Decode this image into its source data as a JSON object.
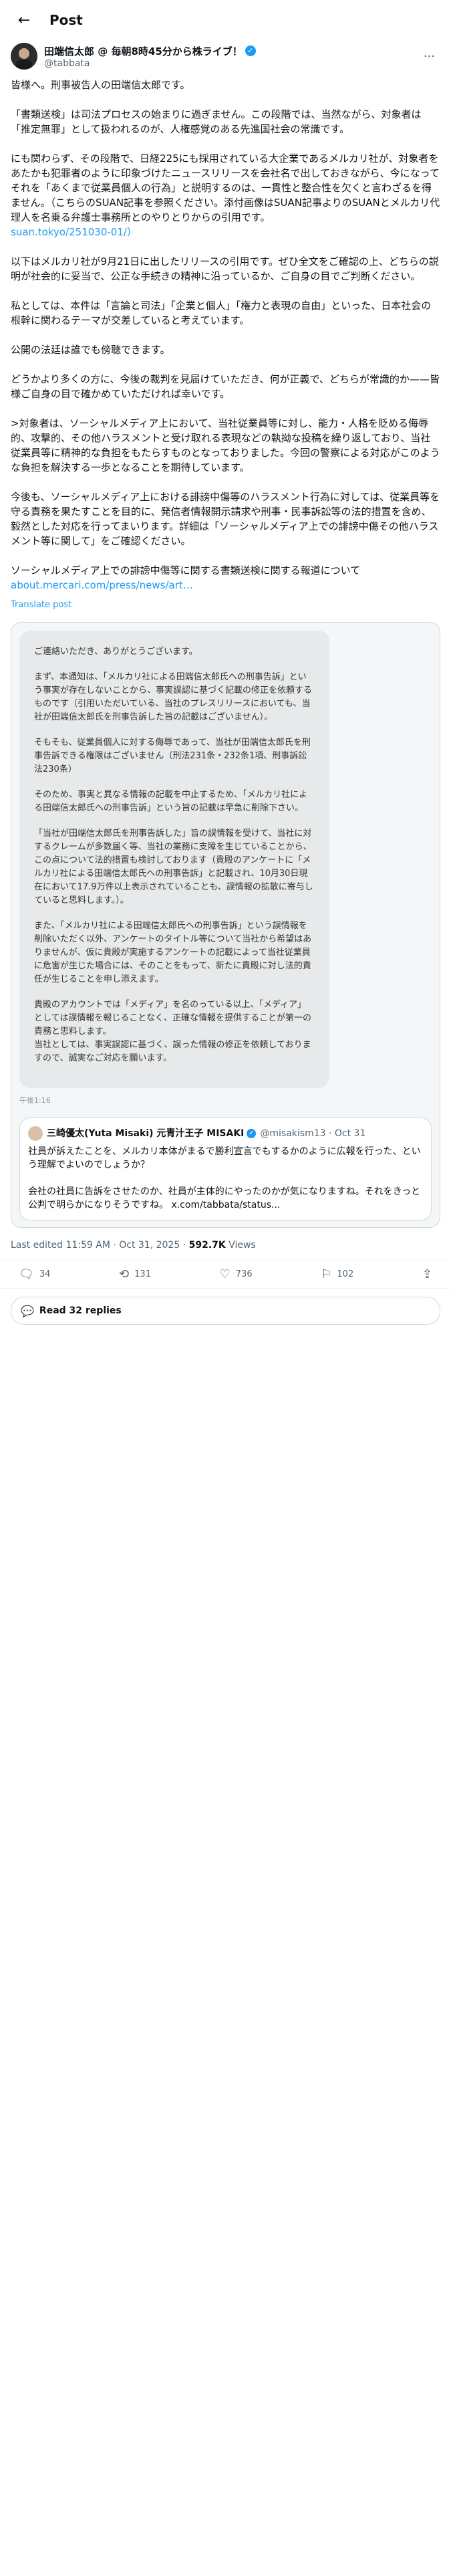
{
  "header": {
    "title": "Post"
  },
  "author": {
    "name": "田端信太郎 @ 毎朝8時45分から株ライブ！",
    "handle": "@tabbata"
  },
  "post": {
    "paragraphs": [
      "皆様へ。刑事被告人の田端信太郎です。",
      "「書類送検」は司法プロセスの始まりに過ぎません。この段階では、当然ながら、対象者は「推定無罪」として扱われるのが、人権感覚のある先進国社会の常識です。",
      "にも関わらず、その段階で、日経225にも採用されている大企業であるメルカリ社が、対象者をあたかも犯罪者のように印象づけたニュースリリースを会社名で出しておきながら、今になってそれを「あくまで従業員個人の行為」と説明するのは、一貫性と整合性を欠くと言わざるを得ません。（こちらのSUAN記事を参照ください。添付画像はSUAN記事よりのSUANとメルカリ代理人を名乗る弁護士事務所とのやりとりからの引用です。",
      "以下はメルカリ社が9月21日に出したリリースの引用です。ぜひ全文をご確認の上、どちらの説明が社会的に妥当で、公正な手続きの精神に沿っているか、ご自身の目でご判断ください。",
      "私としては、本件は「言論と司法」「企業と個人」「権力と表現の自由」といった、日本社会の根幹に関わるテーマが交差していると考えています。",
      "公開の法廷は誰でも傍聴できます。",
      "どうかより多くの方に、今後の裁判を見届けていただき、何が正義で、どちらが常識的か——皆様ご自身の目で確かめていただければ幸いです。",
      ">対象者は、ソーシャルメディア上において、当社従業員等に対し、能力・人格を貶める侮辱的、攻撃的、その他ハラスメントと受け取れる表現などの執拗な投稿を繰り返しており、当社従業員等に精神的な負担をもたらすものとなっておりました。今回の警察による対応がこのような負担を解決する一歩となることを期待しています。",
      "今後も、ソーシャルメディア上における誹謗中傷等のハラスメント行為に対しては、従業員等を守る責務を果たすことを目的に、発信者情報開示請求や刑事・民事訴訟等の法的措置を含め、毅然とした対応を行ってまいります。詳細は「ソーシャルメディア上での誹謗中傷その他ハラスメント等に関して」をご確認ください。",
      "ソーシャルメディア上での誹謗中傷等に関する書類送検に関する報道について"
    ],
    "link1": "suan.tokyo/251030-01/）",
    "link2": "about.mercari.com/press/news/art…",
    "translate": "Translate post"
  },
  "image": {
    "paragraphs": [
      "ご連絡いただき、ありがとうございます。",
      "まず、本通知は、「メルカリ社による田端信太郎氏への刑事告訴」という事実が存在しないことから、事実誤認に基づく記載の修正を依頼するものです（引用いただいている、当社のプレスリリースにおいても、当社が田端信太郎氏を刑事告訴した旨の記載はございません）。",
      "そもそも、従業員個人に対する侮辱であって、当社が田端信太郎氏を刑事告訴できる権限はございません（刑法231条・232条1項、刑事訴訟法230条）",
      "そのため、事実と異なる情報の記載を中止するため、「メルカリ社による田端信太郎氏への刑事告訴」という旨の記載は早急に削除下さい。",
      "「当社が田端信太郎氏を刑事告訴した」旨の誤情報を受けて、当社に対するクレームが多数届く等、当社の業務に支障を生じていることから、この点について法的措置も検討しております（貴殿のアンケートに「メルカリ社による田端信太郎氏への刑事告訴」と記載され、10月30日現在において17.9万件以上表示されていることも、誤情報の拡散に寄与していると思料します。）。",
      "また、「メルカリ社による田端信太郎氏への刑事告訴」という誤情報を削除いただく以外、アンケートのタイトル等について当社から希望はありませんが、仮に貴殿が実施するアンケートの記載によって当社従業員に危害が生じた場合には、そのことをもって、新たに貴殿に対し法的責任が生じることを申し添えます。",
      "貴殿のアカウントでは「メディア」を名のっている以上、「メディア」としては誤情報を報じることなく、正確な情報を提供することが第一の責務と思料します。\n当社としては、事実誤認に基づく、誤った情報の修正を依頼しておりますので、誠実なご対応を願います。"
    ],
    "time": "午後1:16"
  },
  "quote": {
    "name": "三崎優太(Yuta Misaki) 元青汁王子 MISAKI",
    "handle": "@misakism13 · Oct 31",
    "text": "社員が訴えたことを、メルカリ本体がまるで勝利宣言でもするかのように広報を行った、という理解でよいのでしょうか？\n\n会社の社員に告訴をさせたのか、社員が主体的にやったのかが気になりますね。それをきっと公判で明らかになりそうですね。 x.com/tabbata/status..."
  },
  "meta": {
    "time": "Last edited 11:59 AM · Oct 31, 2025 · ",
    "views_count": "592.7K",
    "views_label": " Views"
  },
  "actions": {
    "replies": "34",
    "reposts": "131",
    "likes": "736",
    "bookmarks": "102"
  },
  "read_replies": "Read 32 replies",
  "colors": {
    "link": "#1d9bf0",
    "text": "#0f1419",
    "muted": "#536471"
  }
}
